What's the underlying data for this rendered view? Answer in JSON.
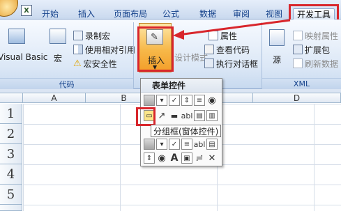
{
  "tabs": [
    "开始",
    "插入",
    "页面布局",
    "公式",
    "数据",
    "审阅",
    "视图",
    "开发工具"
  ],
  "qat_icon": "excel-icon",
  "ribbon": {
    "code_group": {
      "label": "代码",
      "visual_basic": "Visual Basic",
      "macros": "宏",
      "record_macro": "录制宏",
      "relative_refs": "使用相对引用",
      "macro_security": "宏安全性"
    },
    "controls_group": {
      "insert": "插入",
      "design_mode": "设计模式",
      "properties": "属性",
      "view_code": "查看代码",
      "run_dialog": "执行对话框"
    },
    "xml_group": {
      "label": "XML",
      "source": "源",
      "map_properties": "映射属性",
      "expansion_packs": "扩展包",
      "refresh_data": "刷新数据"
    }
  },
  "sheet": {
    "name_box_partial": "A",
    "columns": [
      "A",
      "B",
      "C",
      "D"
    ],
    "rows": [
      "1",
      "2",
      "3",
      "4",
      "5"
    ]
  },
  "dropdown": {
    "title": "表单控件",
    "tooltip": "分组框(窗体控件)",
    "form_row1": [
      "button",
      "combo",
      "check",
      "spinner",
      "listbox",
      "option"
    ],
    "form_row2": [
      "groupbox",
      "label",
      "scrollbar",
      "abl",
      "list2",
      "list3"
    ],
    "activex_row1": [
      "button",
      "combo",
      "check",
      "listbox",
      "abl",
      "list2",
      "option"
    ],
    "activex_row2": [
      "spinner",
      "option",
      "label",
      "image",
      "toggle",
      "scroll",
      "more"
    ]
  },
  "colors": {
    "highlight_red": "#d8262c",
    "ribbon_text": "#15428b",
    "insert_button_orange": "#f7b849"
  }
}
